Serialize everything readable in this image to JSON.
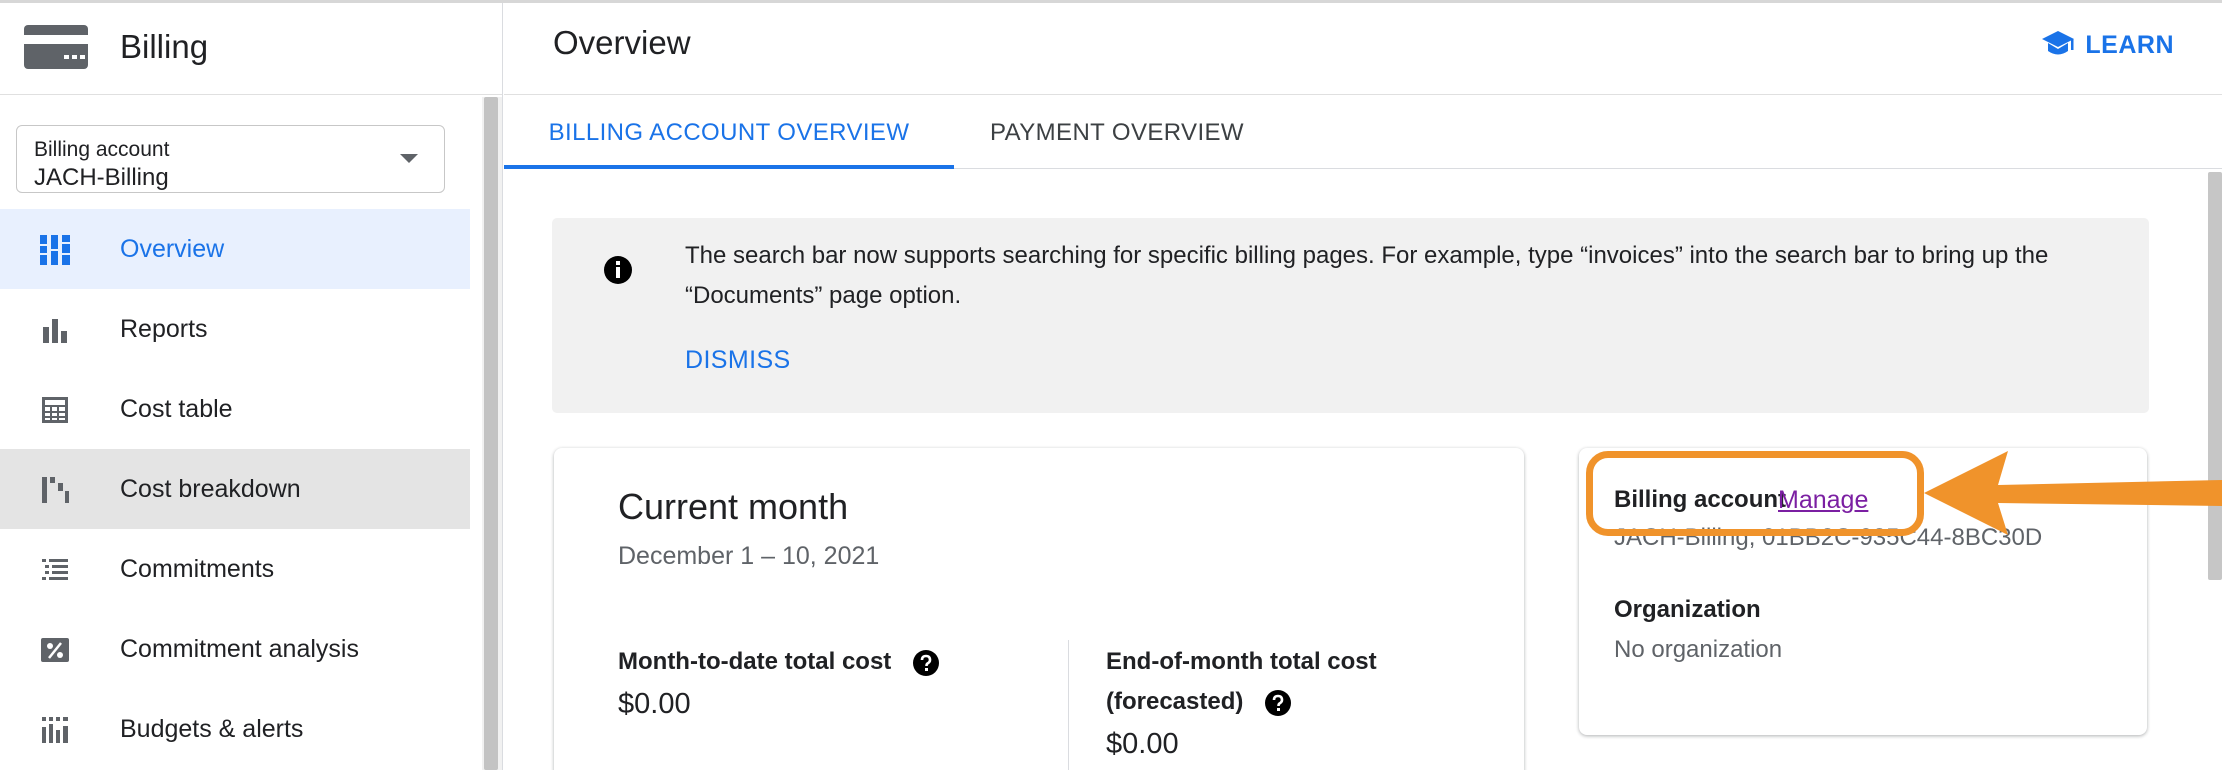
{
  "sidebar": {
    "title": "Billing",
    "account_select": {
      "label": "Billing account",
      "value": "JACH-Billing"
    },
    "items": [
      {
        "label": "Overview",
        "icon": "dashboard-icon",
        "state": "active"
      },
      {
        "label": "Reports",
        "icon": "bar-chart-icon",
        "state": ""
      },
      {
        "label": "Cost table",
        "icon": "table-icon",
        "state": ""
      },
      {
        "label": "Cost breakdown",
        "icon": "waterfall-icon",
        "state": "hover"
      },
      {
        "label": "Commitments",
        "icon": "list-icon",
        "state": ""
      },
      {
        "label": "Commitment analysis",
        "icon": "percent-icon",
        "state": ""
      },
      {
        "label": "Budgets & alerts",
        "icon": "budget-icon",
        "state": ""
      }
    ]
  },
  "header": {
    "title": "Overview",
    "learn_label": "LEARN"
  },
  "tabs": [
    {
      "label": "BILLING ACCOUNT OVERVIEW",
      "selected": true
    },
    {
      "label": "PAYMENT OVERVIEW",
      "selected": false
    }
  ],
  "banner": {
    "text": "The search bar now supports searching for specific billing pages. For example, type “invoices” into the search bar to bring up the “Documents” page option.",
    "dismiss_label": "DISMISS"
  },
  "current_month": {
    "title": "Current month",
    "range": "December 1 – 10, 2021",
    "mtd_label": "Month-to-date total cost",
    "mtd_value": "$0.00",
    "eom_label_line1": "End-of-month total cost",
    "eom_label_line2": "(forecasted)",
    "eom_value": "$0.00"
  },
  "account_card": {
    "label": "Billing account",
    "manage_label": "Manage",
    "account_id": "JACH-Billing, 01BB2C-935C44-8BC30D",
    "org_label": "Organization",
    "org_value": "No organization"
  },
  "colors": {
    "accent": "#1a73e8",
    "highlight": "#f0932b",
    "manage_link": "#7b1fa2"
  }
}
